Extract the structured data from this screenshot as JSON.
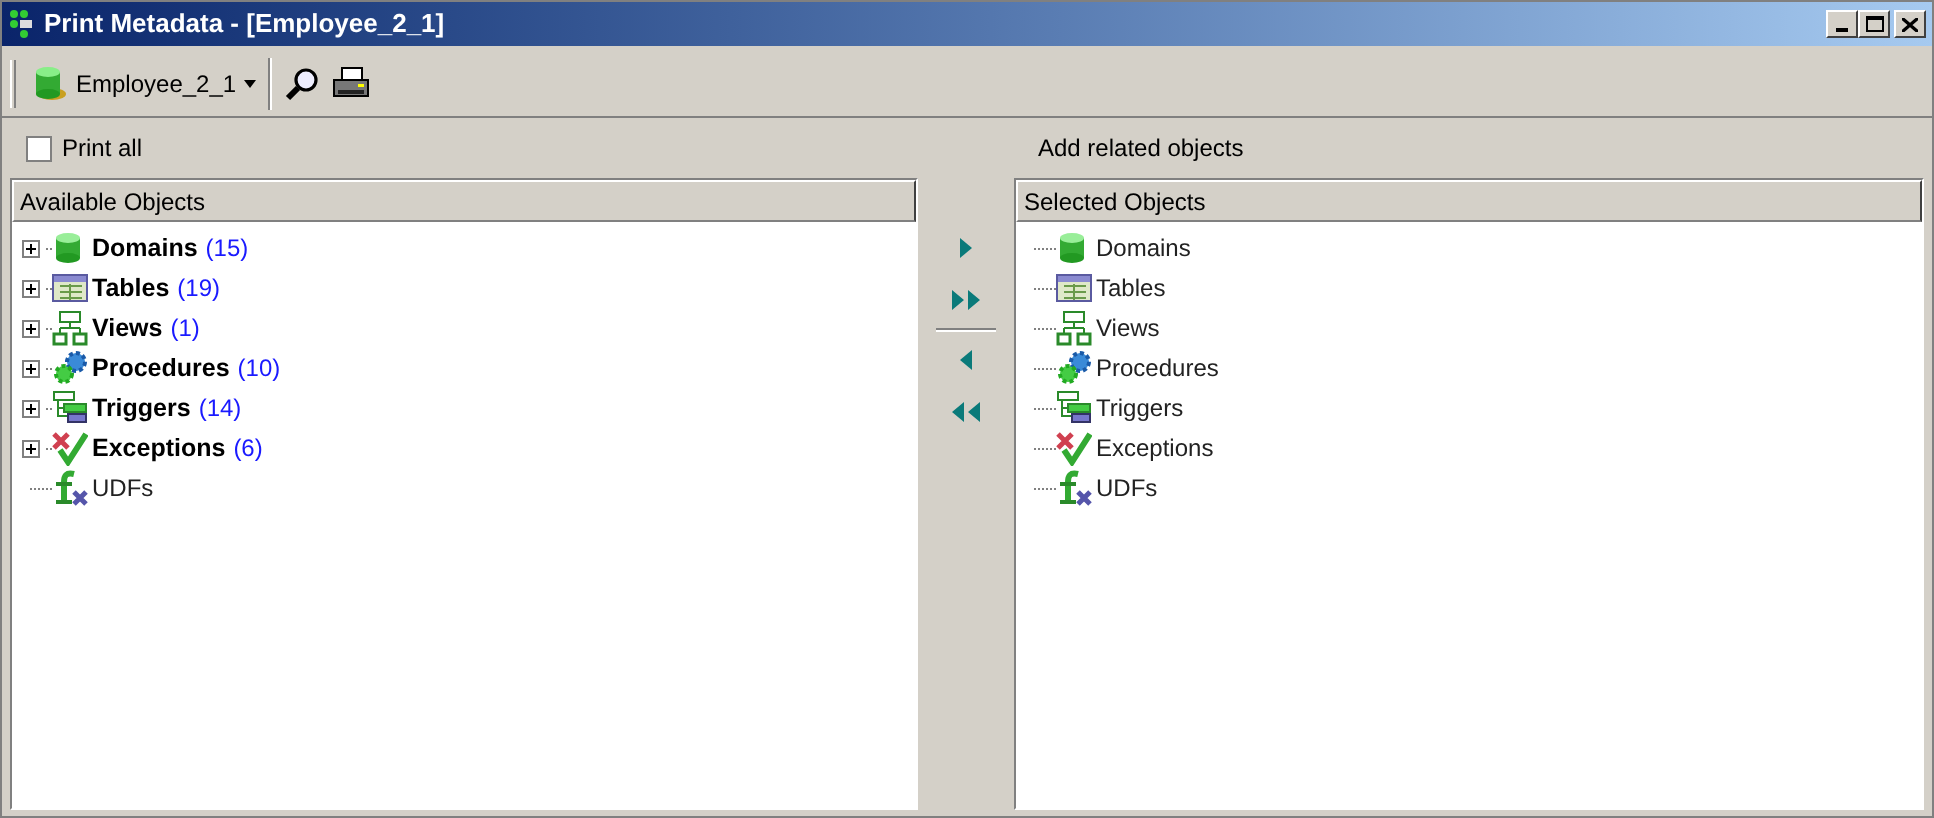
{
  "window": {
    "title": "Print Metadata - [Employee_2_1]"
  },
  "toolbar": {
    "database": "Employee_2_1"
  },
  "print_all": {
    "label": "Print all",
    "checked": false
  },
  "related_label": "Add related objects",
  "available": {
    "header": "Available Objects",
    "items": [
      {
        "kind": "domain",
        "label": "Domains",
        "count": "(15)",
        "expandable": true
      },
      {
        "kind": "table",
        "label": "Tables",
        "count": "(19)",
        "expandable": true
      },
      {
        "kind": "view",
        "label": "Views",
        "count": "(1)",
        "expandable": true
      },
      {
        "kind": "procedure",
        "label": "Procedures",
        "count": "(10)",
        "expandable": true
      },
      {
        "kind": "trigger",
        "label": "Triggers",
        "count": "(14)",
        "expandable": true
      },
      {
        "kind": "exception",
        "label": "Exceptions",
        "count": "(6)",
        "expandable": true
      },
      {
        "kind": "udf",
        "label": "UDFs",
        "expandable": false
      }
    ]
  },
  "selected": {
    "header": "Selected Objects",
    "items": [
      {
        "kind": "domain",
        "label": "Domains",
        "expandable": false
      },
      {
        "kind": "table",
        "label": "Tables",
        "expandable": false
      },
      {
        "kind": "view",
        "label": "Views",
        "expandable": false
      },
      {
        "kind": "procedure",
        "label": "Procedures",
        "expandable": false
      },
      {
        "kind": "trigger",
        "label": "Triggers",
        "expandable": false
      },
      {
        "kind": "exception",
        "label": "Exceptions",
        "expandable": false
      },
      {
        "kind": "udf",
        "label": "UDFs",
        "expandable": false
      }
    ]
  }
}
